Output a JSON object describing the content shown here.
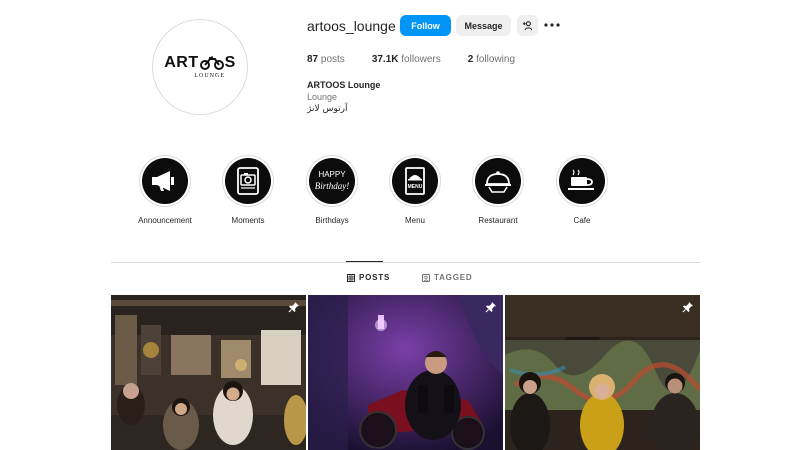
{
  "profile": {
    "username": "artoos_lounge",
    "logo_text": "ARTOOS",
    "logo_sub": "LOUNGE",
    "follow_label": "Follow",
    "message_label": "Message",
    "add_user_icon": "add-person-icon",
    "more_icon": "more-options-icon"
  },
  "stats": {
    "posts_count": "87",
    "posts_label": "posts",
    "followers_count": "37.1K",
    "followers_label": "followers",
    "following_count": "2",
    "following_label": "following"
  },
  "bio": {
    "display_name": "ARTOOS Lounge",
    "category": "Lounge",
    "persian_name": "آرتوس لانژ"
  },
  "highlights": [
    {
      "label": "Announcement",
      "icon": "megaphone-icon"
    },
    {
      "label": "Moments",
      "icon": "camera-album-icon"
    },
    {
      "label": "Birthdays",
      "icon": "happy-birthday-icon"
    },
    {
      "label": "Menu",
      "icon": "menu-book-icon"
    },
    {
      "label": "Restaurant",
      "icon": "cloche-icon"
    },
    {
      "label": "Cafe",
      "icon": "coffee-cup-icon"
    }
  ],
  "birthday_icon_text": {
    "line1": "HAPPY",
    "line2": "Birthday!"
  },
  "menu_icon_text": "MENU",
  "tabs": [
    {
      "label": "POSTS",
      "icon": "grid-icon",
      "active": true
    },
    {
      "label": "TAGGED",
      "icon": "tagged-icon",
      "active": false
    }
  ],
  "posts": [
    {
      "pinned": true,
      "scene": "three women seated in cafe"
    },
    {
      "pinned": true,
      "scene": "man on red motorcycle under purple light"
    },
    {
      "pinned": true,
      "scene": "group seated in front of graffiti wall"
    }
  ],
  "colors": {
    "follow_button": "#0095f6",
    "secondary_button": "#efefef",
    "border": "#dbdbdb",
    "muted_text": "#737373",
    "primary_text": "#262626"
  }
}
